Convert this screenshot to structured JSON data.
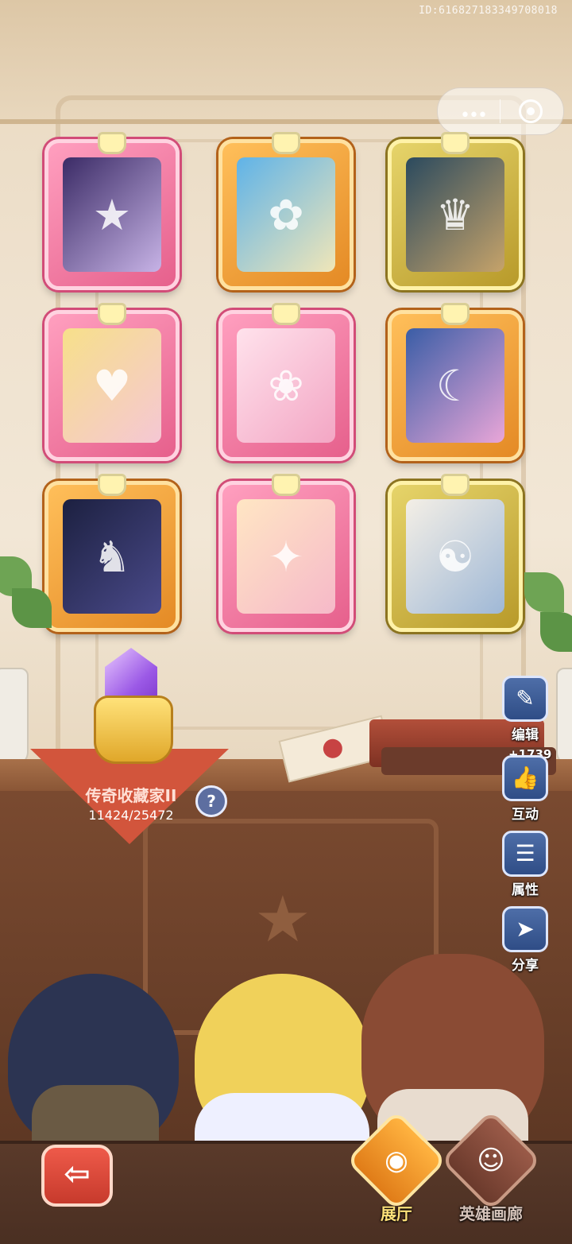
{
  "header": {
    "id_text": "ID:616827183349708018"
  },
  "capsule": {
    "more_icon": "more-dots-icon",
    "close_icon": "target-circle-icon"
  },
  "frames": [
    {
      "name": "hero-frame-1",
      "style": "pink",
      "icon": "★"
    },
    {
      "name": "hero-frame-2",
      "style": "orange",
      "icon": "✿"
    },
    {
      "name": "hero-frame-3",
      "style": "gold",
      "icon": "♛"
    },
    {
      "name": "hero-frame-4",
      "style": "pink",
      "icon": "♥"
    },
    {
      "name": "hero-frame-5",
      "style": "pink",
      "icon": "❀"
    },
    {
      "name": "hero-frame-6",
      "style": "orange",
      "icon": "☾"
    },
    {
      "name": "hero-frame-7",
      "style": "orange",
      "icon": "♞"
    },
    {
      "name": "hero-frame-8",
      "style": "pink",
      "icon": "✦"
    },
    {
      "name": "hero-frame-9",
      "style": "gold",
      "icon": "☯"
    }
  ],
  "collector": {
    "title": "传奇收藏家II",
    "progress": "11424/25472",
    "help_label": "?"
  },
  "side_actions": {
    "edit_label": "编辑",
    "interact_label": "互动",
    "likes": "+1739",
    "attributes_label": "属性",
    "share_label": "分享"
  },
  "bottom_nav": {
    "back_icon": "back-arrow-icon",
    "gallery_label": "展厅",
    "heroes_label": "英雄画廊"
  },
  "colors": {
    "pink_frame": "#e6608c",
    "orange_frame": "#e48a25",
    "gold_frame": "#b89a2a",
    "banner": "#d2553c",
    "button_blue": "#2f4d86"
  }
}
